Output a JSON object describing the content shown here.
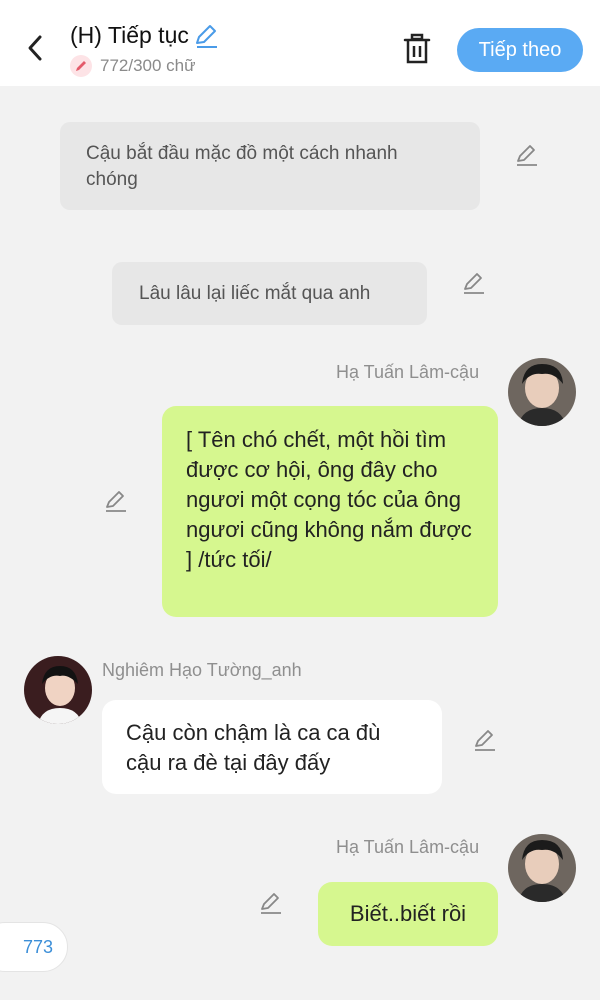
{
  "header": {
    "title": "(H) Tiếp tục",
    "word_count": "772/300 chữ",
    "next_label": "Tiếp theo"
  },
  "messages": {
    "narration_1": "Cậu bắt đầu mặc đồ một cách nhanh chóng",
    "narration_2": "Lâu lâu lại liếc mắt qua anh",
    "msg1": {
      "sender": "Hạ Tuấn Lâm-cậu",
      "text": "[ Tên chó chết, một hồi tìm được cơ hội, ông đây cho ngươi một cọng tóc của ông ngươi cũng không nắm được ] /tức tối/"
    },
    "msg2": {
      "sender": "Nghiêm Hạo Tường_anh",
      "text": "Cậu còn chậm là ca ca đù cậu ra đè tại đây đấy"
    },
    "msg3": {
      "sender": "Hạ Tuấn Lâm-cậu",
      "text": "Biết..biết rồi"
    }
  },
  "footer": {
    "count": "773"
  },
  "colors": {
    "accent": "#5aaaf3",
    "green_bubble": "#d6f78f",
    "narration_bg": "#e7e7e7",
    "background": "#f2f2f2"
  },
  "icons": [
    "back-icon",
    "pencil-icon",
    "trash-icon",
    "avatar"
  ]
}
